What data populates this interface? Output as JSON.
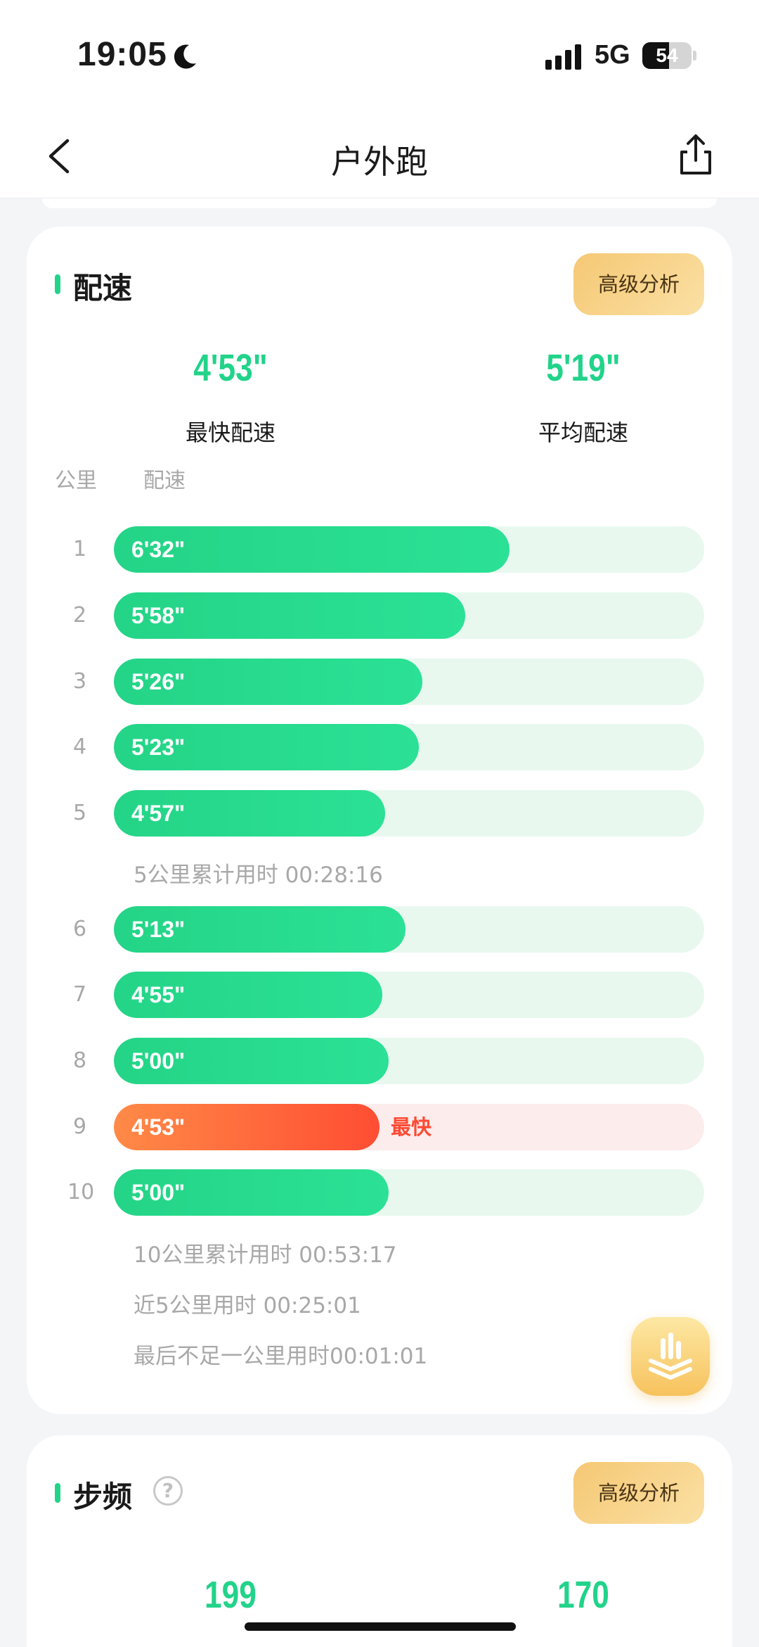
{
  "status_bar": {
    "time": "19:05",
    "network": "5G",
    "battery": "54",
    "battery_level": 0.54
  },
  "nav": {
    "title": "户外跑"
  },
  "pace_section": {
    "title": "配速",
    "advanced_label": "高级分析",
    "fastest_value": "4'53\"",
    "fastest_label": "最快配速",
    "average_value": "5'19\"",
    "average_label": "平均配速",
    "col_km": "公里",
    "col_pace": "配速",
    "fastest_tag": "最快",
    "splits": [
      {
        "km": "1",
        "pace": "6'32\"",
        "fill": 0.67
      },
      {
        "km": "2",
        "pace": "5'58\"",
        "fill": 0.595
      },
      {
        "km": "3",
        "pace": "5'26\"",
        "fill": 0.523
      },
      {
        "km": "4",
        "pace": "5'23\"",
        "fill": 0.517
      },
      {
        "km": "5",
        "pace": "4'57\"",
        "fill": 0.459
      },
      {
        "km": "6",
        "pace": "5'13\"",
        "fill": 0.494
      },
      {
        "km": "7",
        "pace": "4'55\"",
        "fill": 0.455
      },
      {
        "km": "8",
        "pace": "5'00\"",
        "fill": 0.465
      },
      {
        "km": "9",
        "pace": "4'53\"",
        "fill": 0.45,
        "fastest": true
      },
      {
        "km": "10",
        "pace": "5'00\"",
        "fill": 0.465
      }
    ],
    "note_5km": "5公里累计用时 00:28:16",
    "note_10km": "10公里累计用时 00:53:17",
    "note_last5": "近5公里用时 00:25:01",
    "note_remainder": "最后不足一公里用时00:01:01"
  },
  "cadence_section": {
    "title": "步频",
    "help_symbol": "?",
    "advanced_label": "高级分析",
    "max_value": "199",
    "avg_value": "170"
  },
  "colors": {
    "accent_green": "#22d38a",
    "fastest_orange": "#ff4d33",
    "button_gold": "#f5c874"
  }
}
